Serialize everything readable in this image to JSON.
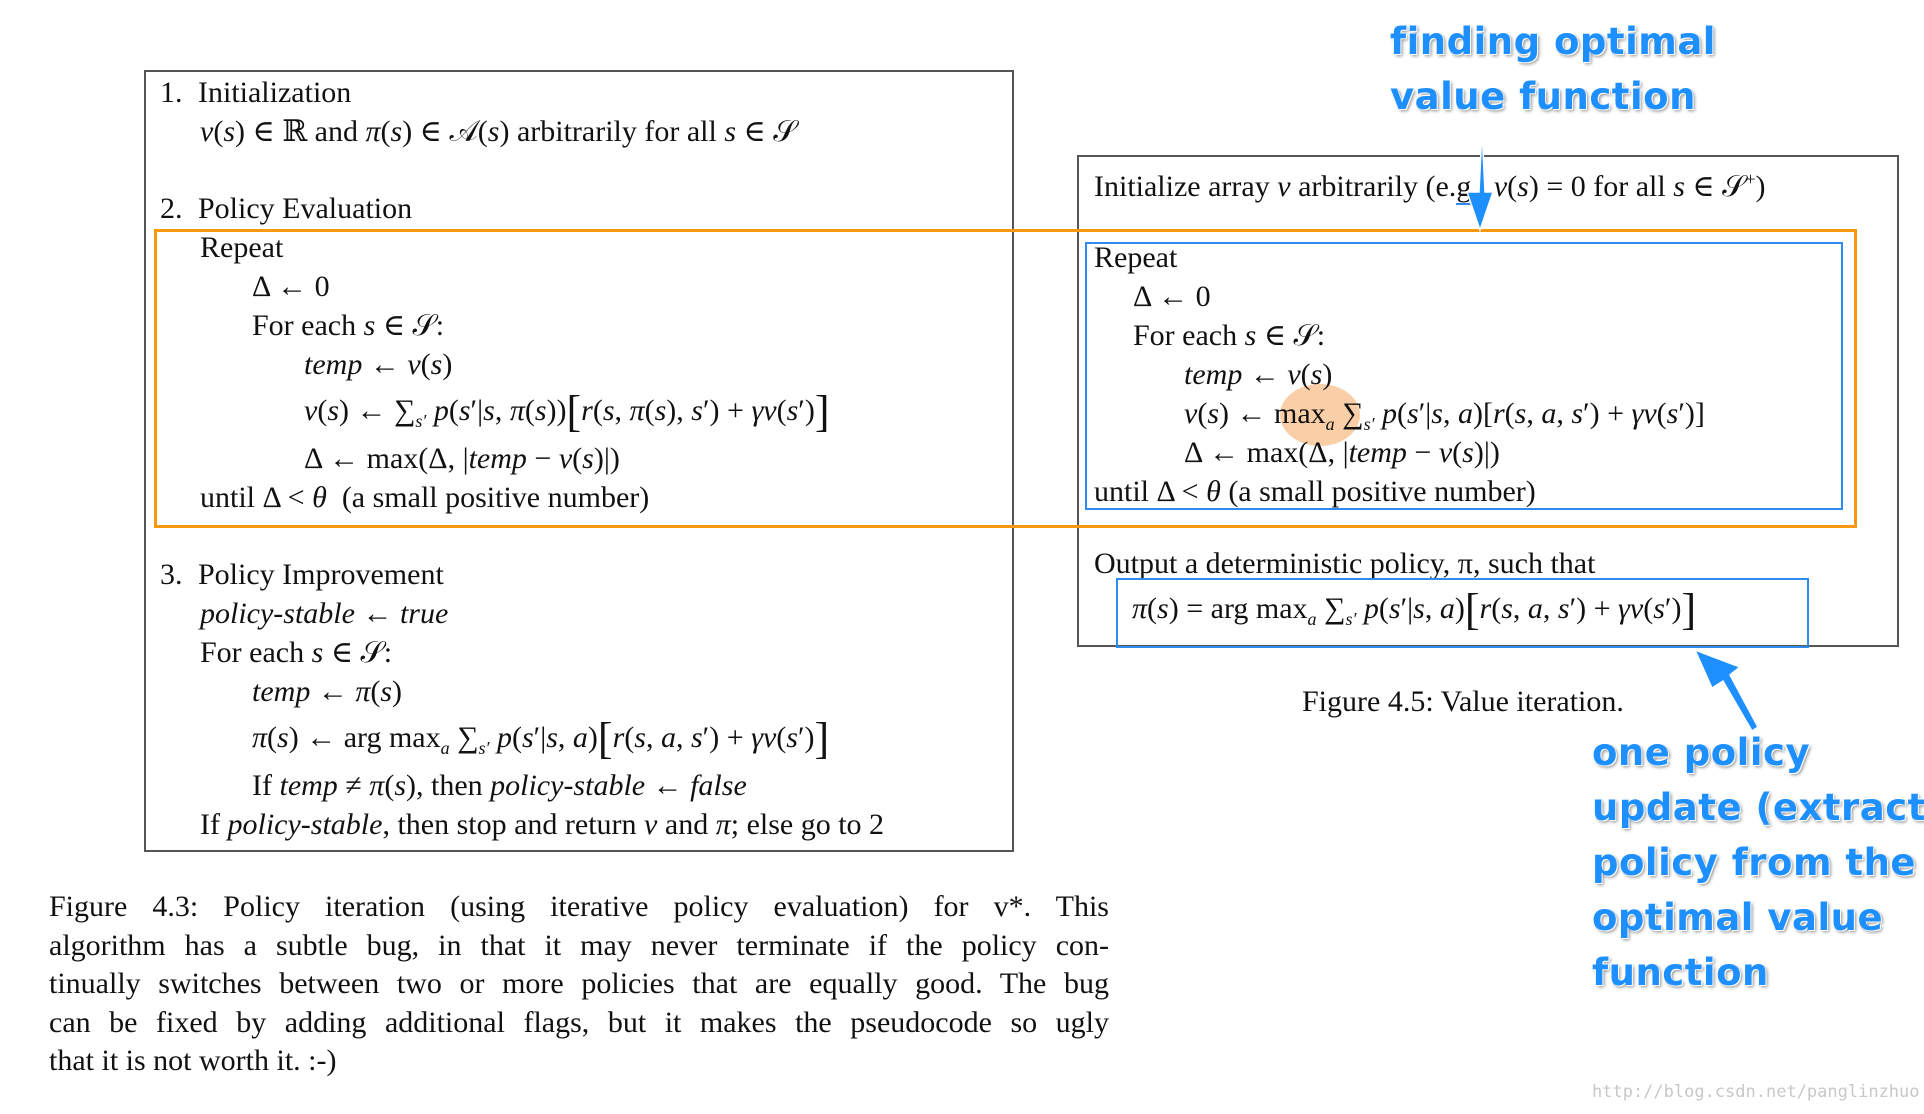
{
  "policy_iteration": {
    "steps": [
      {
        "number": "1.",
        "title": "Initialization",
        "lines": [
          "v(s) ∈ ℝ and π(s) ∈ 𝒜(s) arbitrarily for all s ∈ 𝒮"
        ]
      },
      {
        "number": "2.",
        "title": "Policy Evaluation",
        "lines": [
          "Repeat",
          "Δ ← 0",
          "For each s ∈ 𝒮:",
          "temp ← v(s)",
          "v(s) ← Σs′ p(s′|s, π(s)) [ r(s, π(s), s′) + γv(s′) ]",
          "Δ ← max(Δ, |temp − v(s)|)",
          "until Δ < θ  (a small positive number)"
        ]
      },
      {
        "number": "3.",
        "title": "Policy Improvement",
        "lines": [
          "policy-stable ← true",
          "For each s ∈ 𝒮:",
          "temp ← π(s)",
          "π(s) ← arg maxa Σs′ p(s′|s, a) [ r(s, a, s′) + γv(s′) ]",
          "If temp ≠ π(s), then policy-stable ← false",
          "If policy-stable, then stop and return v and π; else go to 2"
        ]
      }
    ],
    "caption": "Figure 4.3: Policy iteration (using iterative policy evaluation) for v*. This algorithm has a subtle bug, in that it may never terminate if the policy continually switches between two or more policies that are equally good. The bug can be fixed by adding additional flags, but it makes the pseudocode so ugly that it is not worth it. :-)",
    "caption_lines": [
      "Figure 4.3:  Policy iteration (using iterative policy evaluation) for v*.  This",
      "algorithm has a subtle bug, in that it may never terminate if the policy con-",
      "tinually switches between two or more policies that are equally good. The bug",
      "can be fixed by adding additional flags, but it makes the pseudocode so ugly",
      "that it is not worth it. :-)"
    ]
  },
  "value_iteration": {
    "init_line": "Initialize array v arbitrarily (e.g., v(s) = 0 for all s ∈ 𝒮⁺)",
    "loop_lines": [
      "Repeat",
      "Δ ← 0",
      "For each s ∈ 𝒮:",
      "temp ← v(s)",
      "v(s) ← maxa Σs′ p(s′|s, a)[r(s, a, s′) + γv(s′)]",
      "Δ ← max(Δ, |temp − v(s)|)",
      "until Δ < θ (a small positive number)"
    ],
    "output_line": "Output a deterministic policy, π, such that",
    "output_formula": "π(s) = arg maxa Σs′ p(s′|s, a) [ r(s, a, s′) + γv(s′) ]",
    "caption": "Figure 4.5:  Value iteration."
  },
  "annotations": {
    "top": [
      "finding optimal",
      "value function"
    ],
    "bottom": [
      "one policy",
      "update (extract",
      "policy from the",
      "optimal value",
      "function"
    ]
  },
  "colors": {
    "orange_highlight": "#f7980f",
    "blue_annotation": "#1e8fff",
    "blue_box": "#2d8cf0",
    "max_highlight": "#f7b06e"
  },
  "watermark": "http://blog.csdn.net/panglinzhuo"
}
